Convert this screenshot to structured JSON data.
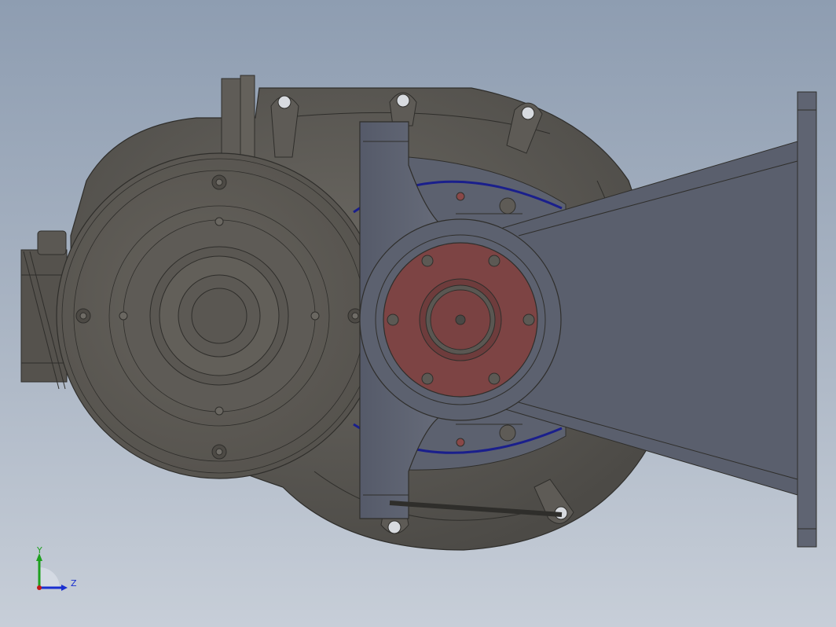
{
  "viewport": {
    "background_top": "#8e9db1",
    "background_bottom": "#c7ced8"
  },
  "model": {
    "body_color": "#5c5954",
    "bracket_color": "#5b6070",
    "flange_color": "#7d4444",
    "seal_ring_color": "#1a1f8c"
  },
  "triad": {
    "y_label": "Y",
    "z_label": "Z",
    "y_color": "#1ea01e",
    "z_color": "#1a2fd0",
    "origin_color": "#c01818"
  }
}
